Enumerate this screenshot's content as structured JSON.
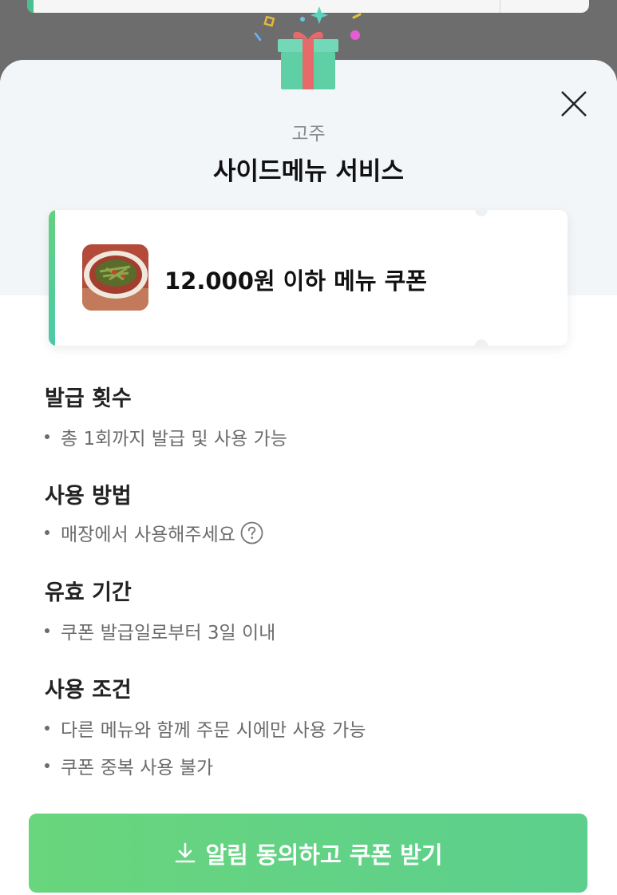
{
  "modal": {
    "store_name": "고주",
    "title": "사이드메뉴 서비스"
  },
  "coupon": {
    "text": "12.000원 이하 메뉴 쿠폰",
    "thumbnail_icon": "food-thumbnail"
  },
  "sections": [
    {
      "title": "발급 횟수",
      "items": [
        "총 1회까지 발급 및 사용 가능"
      ]
    },
    {
      "title": "사용 방법",
      "items": [
        "매장에서 사용해주세요"
      ]
    },
    {
      "title": "유효 기간",
      "items": [
        "쿠폰 발급일로부터 3일 이내"
      ]
    },
    {
      "title": "사용 조건",
      "items": [
        "다른 메뉴와 함께 주문 시에만 사용 가능",
        "쿠폰 중복 사용 불가"
      ]
    }
  ],
  "cta": {
    "label": "알림 동의하고 쿠폰 받기",
    "icon": "download-icon"
  },
  "colors": {
    "accent": "#62d27f",
    "accent_end": "#4cc9a9",
    "gift_box": "#5fd0a6",
    "gift_ribbon": "#e66a6a"
  }
}
